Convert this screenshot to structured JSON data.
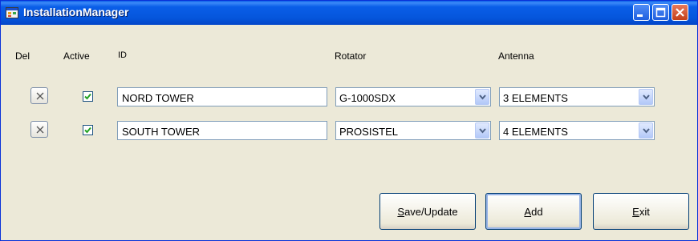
{
  "window": {
    "title": "InstallationManager"
  },
  "headers": {
    "del": "Del",
    "active": "Active",
    "id": "ID",
    "rotator": "Rotator",
    "antenna": "Antenna"
  },
  "rows": [
    {
      "active": true,
      "id": "NORD TOWER",
      "rotator": "G-1000SDX",
      "antenna": "3 ELEMENTS"
    },
    {
      "active": true,
      "id": "SOUTH TOWER",
      "rotator": "PROSISTEL",
      "antenna": "4 ELEMENTS"
    }
  ],
  "buttons": {
    "save_update": {
      "mnemonic": "S",
      "rest": "ave/Update"
    },
    "add": {
      "mnemonic": "A",
      "rest": "dd"
    },
    "exit": {
      "mnemonic": "E",
      "rest": "xit"
    }
  },
  "colors": {
    "titlebar": "#0a5ee8",
    "window_bg": "#ece9d8",
    "checkmark": "#21a121",
    "field_border": "#7f9db9"
  }
}
